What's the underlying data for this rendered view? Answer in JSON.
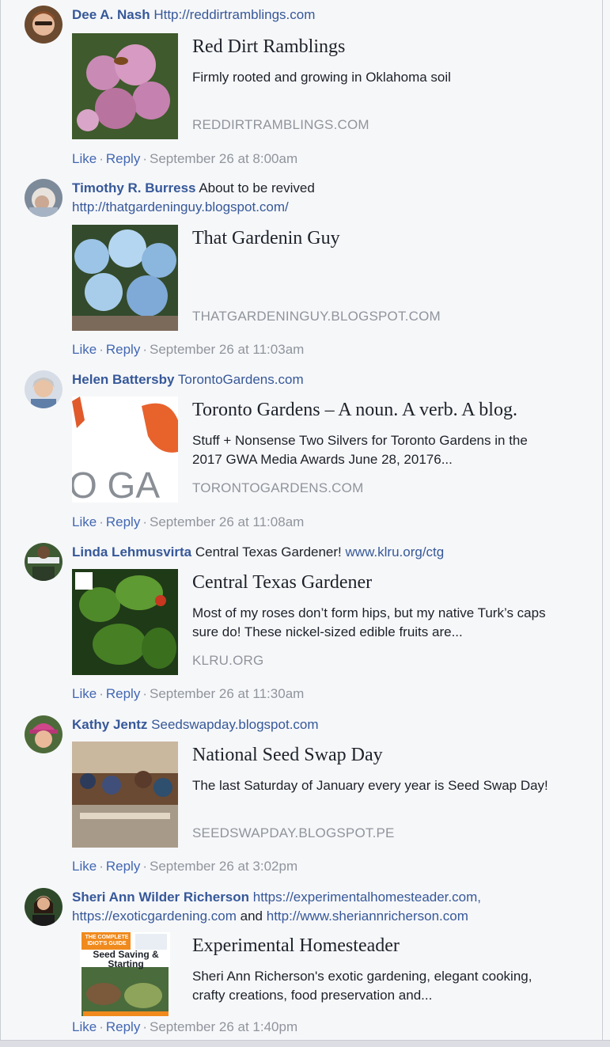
{
  "comments": [
    {
      "author": "Dee A. Nash",
      "text_prefix": "",
      "link_text": "Http://reddirtramblings.com",
      "line2": "",
      "card": {
        "title": "Red Dirt Ramblings",
        "description": "Firmly rooted and growing in Oklahoma soil",
        "domain": "REDDIRTRAMBLINGS.COM"
      },
      "like": "Like",
      "reply": "Reply",
      "time": "September 26 at 8:00am"
    },
    {
      "author": "Timothy R. Burress",
      "text_prefix": "About to be revived",
      "link_text": "",
      "line2": "http://thatgardeninguy.blogspot.com/",
      "card": {
        "title": "That Gardenin Guy",
        "description": "",
        "domain": "THATGARDENINGUY.BLOGSPOT.COM"
      },
      "like": "Like",
      "reply": "Reply",
      "time": "September 26 at 11:03am"
    },
    {
      "author": "Helen Battersby",
      "text_prefix": "",
      "link_text": "TorontoGardens.com",
      "line2": "",
      "card": {
        "title": "Toronto Gardens – A noun. A verb. A blog.",
        "description": "Stuff + Nonsense Two Silvers for Toronto Gardens in the 2017 GWA Media Awards June 28, 20176...",
        "domain": "TORONTOGARDENS.COM"
      },
      "like": "Like",
      "reply": "Reply",
      "time": "September 26 at 11:08am"
    },
    {
      "author": "Linda Lehmusvirta",
      "text_prefix": "Central Texas Gardener!",
      "link_text": "www.klru.org/ctg",
      "line2": "",
      "card": {
        "title": "Central Texas Gardener",
        "description": "Most of my roses don’t form hips, but my native Turk’s caps sure do! These nickel-sized edible fruits are...",
        "domain": "KLRU.ORG"
      },
      "like": "Like",
      "reply": "Reply",
      "time": "September 26 at 11:30am"
    },
    {
      "author": "Kathy Jentz",
      "text_prefix": "",
      "link_text": "Seedswapday.blogspot.com",
      "line2": "",
      "card": {
        "title": "National Seed Swap Day",
        "description": "The last Saturday of January every year is Seed Swap Day!",
        "domain": "SEEDSWAPDAY.BLOGSPOT.PE"
      },
      "like": "Like",
      "reply": "Reply",
      "time": "September 26 at 3:02pm"
    },
    {
      "author": "Sheri Ann Wilder Richerson",
      "text_prefix": "",
      "link_text": "https://experimentalhomesteader.com,",
      "line2_link1": "https://exoticgardening.com",
      "line2_and": "and",
      "line2_link2": "http://www.sheriannricherson.com",
      "card": {
        "title": "Experimental Homesteader",
        "description": "Sheri Ann Richerson's exotic gardening, elegant cooking, crafty creations, food preservation and...",
        "domain": ""
      },
      "book_cover": {
        "brand": "THE COMPLETE IDIOT'S GUIDE",
        "title": "Seed Saving & Starting"
      },
      "like": "Like",
      "reply": "Reply",
      "time": "September 26 at 1:40pm"
    }
  ]
}
